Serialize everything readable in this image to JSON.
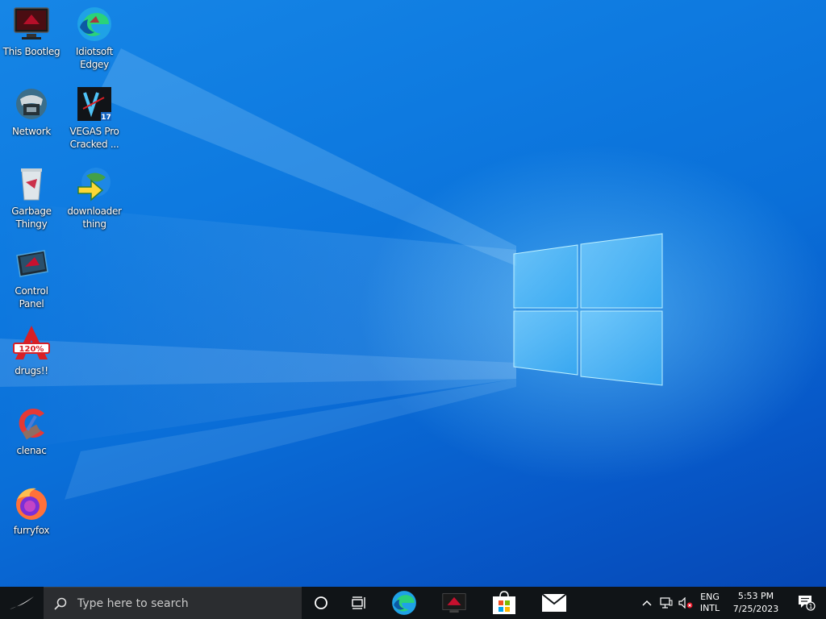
{
  "desktop": {
    "wallpaper": "windows-10-hero",
    "accent": "#0a6fd8",
    "icons": [
      {
        "label": "This Bootleg",
        "icon": "this-pc-icon"
      },
      {
        "label": "Idiotsoft\nEdgey",
        "icon": "edge-icon"
      },
      {
        "label": "Network",
        "icon": "network-icon"
      },
      {
        "label": "VEGAS Pro\nCracked ...",
        "icon": "vegas-pro-icon"
      },
      {
        "label": "Garbage\nThingy",
        "icon": "recycle-bin-icon"
      },
      {
        "label": "downloader\nthing",
        "icon": "downloader-icon"
      },
      {
        "label": "Control\nPanel",
        "icon": "control-panel-icon"
      },
      {
        "label": "drugs!!",
        "icon": "drugs-app-icon"
      },
      {
        "label": "clenac",
        "icon": "ccleaner-icon"
      },
      {
        "label": "furryfox",
        "icon": "firefox-icon"
      }
    ],
    "vegas_badge": "17",
    "drugs_badge": "120%"
  },
  "taskbar": {
    "search_placeholder": "Type here to search",
    "pinned": [
      "cortana-icon",
      "task-view-icon",
      "edge-icon",
      "rog-app-icon",
      "store-icon",
      "mail-icon"
    ],
    "tray": {
      "lang_line1": "ENG",
      "lang_line2": "INTL",
      "time": "5:53 PM",
      "date": "7/25/2023",
      "notification_count": "1"
    }
  }
}
